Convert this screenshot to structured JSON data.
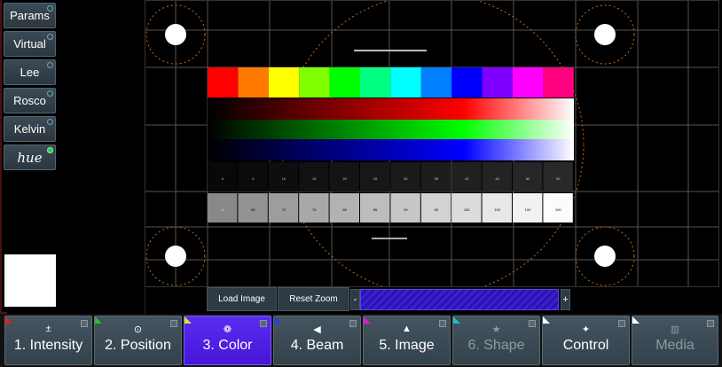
{
  "side_panel": {
    "buttons": [
      {
        "label": "Params",
        "active": false
      },
      {
        "label": "Virtual",
        "active": false
      },
      {
        "label": "Lee",
        "active": false
      },
      {
        "label": "Rosco",
        "active": false
      },
      {
        "label": "Kelvin",
        "active": false
      },
      {
        "label": "hue",
        "active": true
      }
    ]
  },
  "pattern": {
    "color_bars": [
      "#ff0000",
      "#ff7a00",
      "#ffff00",
      "#80ff00",
      "#00ff00",
      "#00ff80",
      "#00ffff",
      "#0080ff",
      "#0000ff",
      "#8000ff",
      "#ff00ff",
      "#ff0080"
    ],
    "gray_row1_labels": [
      "0",
      "5",
      "10",
      "15",
      "20",
      "25",
      "30",
      "35",
      "40",
      "45",
      "50",
      "55"
    ],
    "gray_row2_labels": [
      "60",
      "65",
      "70",
      "75",
      "80",
      "85",
      "90",
      "95",
      "100",
      "100",
      "100",
      "100"
    ]
  },
  "image_controls": {
    "load_image": "Load Image",
    "reset_zoom": "Reset Zoom",
    "minus": "-",
    "plus": "+"
  },
  "tabs": [
    {
      "label": "1. Intensity",
      "icon": "±",
      "icon_name": "intensity-icon",
      "corner_color": "#e02020",
      "active": false,
      "dim": false
    },
    {
      "label": "2. Position",
      "icon": "⊙",
      "icon_name": "position-icon",
      "corner_color": "#30c030",
      "active": false,
      "dim": false
    },
    {
      "label": "3. Color",
      "icon": "❁",
      "icon_name": "color-icon",
      "corner_color": "#e0e020",
      "active": true,
      "dim": false
    },
    {
      "label": "4. Beam",
      "icon": "◀",
      "icon_name": "beam-icon",
      "corner_color": "#2040e0",
      "active": false,
      "dim": false
    },
    {
      "label": "5. Image",
      "icon": "▲",
      "icon_name": "image-icon",
      "corner_color": "#d020d0",
      "active": false,
      "dim": false
    },
    {
      "label": "6. Shape",
      "icon": "★",
      "icon_name": "shape-icon",
      "corner_color": "#20c0c0",
      "active": false,
      "dim": true
    },
    {
      "label": "Control",
      "icon": "✦",
      "icon_name": "control-icon",
      "corner_color": "#ffffff",
      "active": false,
      "dim": false
    },
    {
      "label": "Media",
      "icon": "▥",
      "icon_name": "media-icon",
      "corner_color": "#ffffff",
      "active": false,
      "dim": true
    }
  ]
}
